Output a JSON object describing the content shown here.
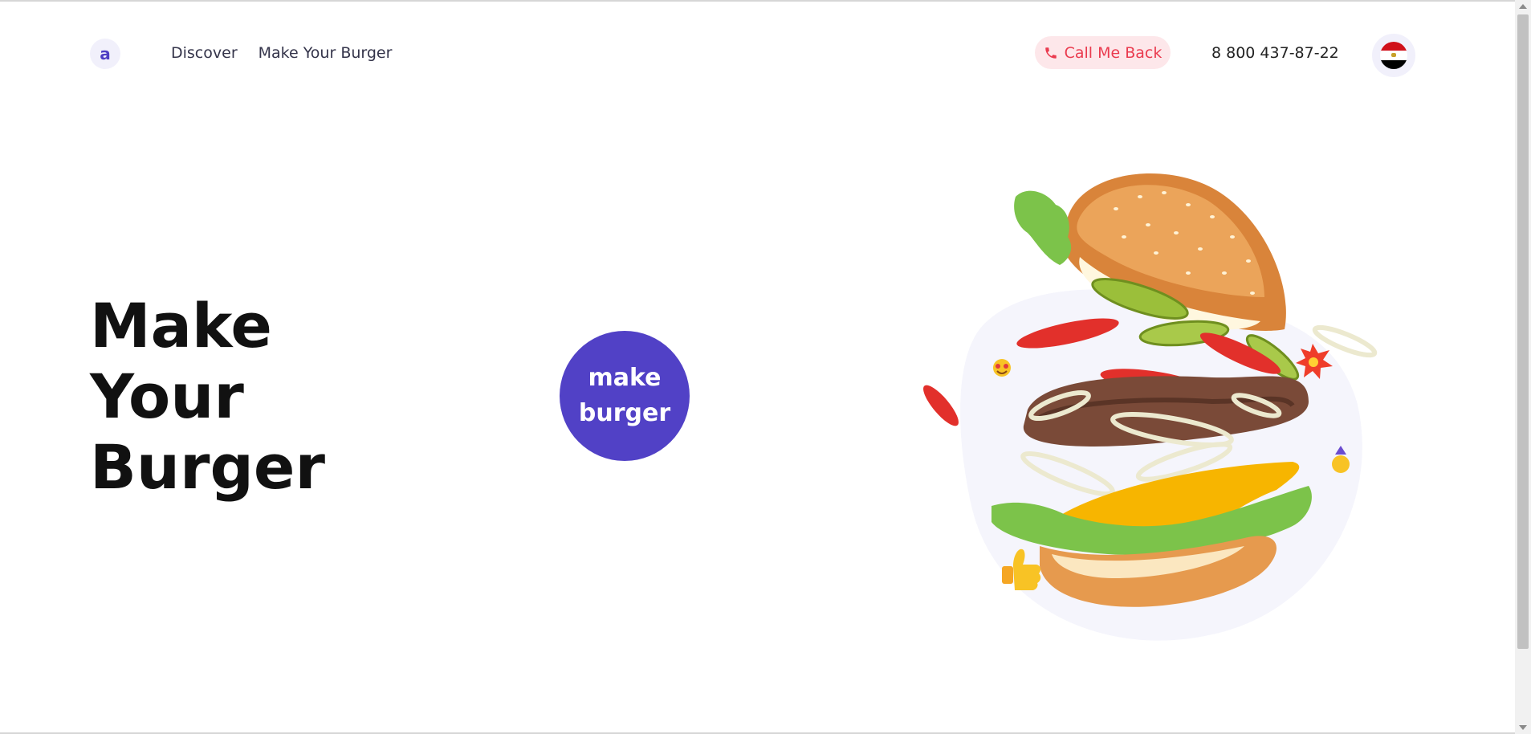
{
  "header": {
    "logo_letter": "a",
    "nav": [
      "Discover",
      "Make Your Burger"
    ],
    "callback_label": "Call Me Back",
    "phone": "8 800 437-87-22"
  },
  "hero": {
    "title": "Make Your Burger",
    "cta_line1": "make",
    "cta_line2": "burger"
  },
  "colors": {
    "accent": "#5141c6",
    "callback_bg": "#fde7ea",
    "callback_text": "#ea3b4f"
  },
  "icons": {
    "phone": "phone-icon",
    "flag": "egypt-flag-icon"
  }
}
